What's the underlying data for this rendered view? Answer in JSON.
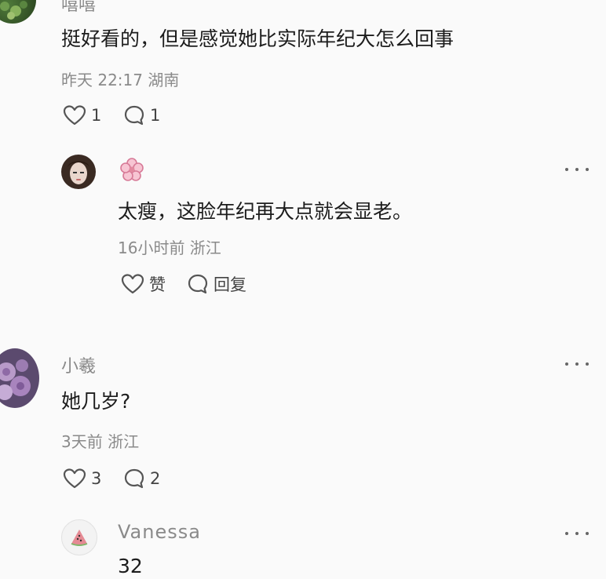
{
  "comments": [
    {
      "name": "嘻嘻",
      "text": "挺好看的，但是感觉她比实际年纪大怎么回事",
      "time": "昨天 22:17 湖南",
      "likes": "1",
      "replies": "1",
      "avatar_icon": "green-plant-avatar"
    },
    {
      "name": "",
      "name_icon": "pink-flower-icon",
      "text": "太瘦，这脸年纪再大点就会显老。",
      "time": "16小时前 浙江",
      "like_label": "赞",
      "reply_label": "回复",
      "avatar_icon": "woman-portrait-avatar"
    },
    {
      "name": "小羲",
      "text": "她几岁?",
      "time": "3天前 浙江",
      "likes": "3",
      "replies": "2",
      "avatar_icon": "purple-roses-avatar"
    },
    {
      "name": "Vanessa",
      "text": "32",
      "avatar_icon": "watermelon-slice-avatar"
    }
  ],
  "colors": {
    "background": "#fafafa",
    "meta_text": "#8a8a8a",
    "body_text": "#1c1c1c"
  }
}
